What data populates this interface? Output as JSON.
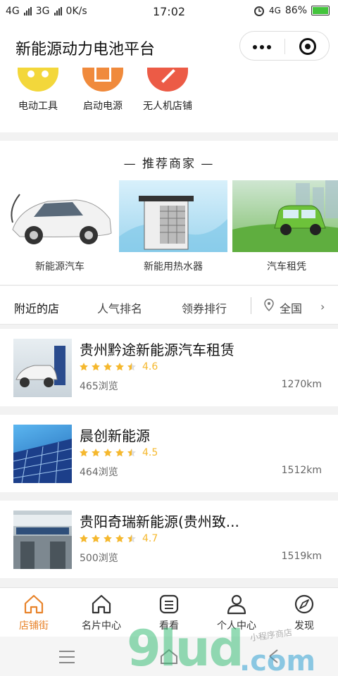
{
  "status_bar": {
    "net1": "4G",
    "net2": "3G",
    "speed": "0K/s",
    "time": "17:02",
    "net3": "4G",
    "battery": "86%"
  },
  "nav": {
    "title": "新能源动力电池平台"
  },
  "categories": [
    {
      "label": "电动工具",
      "color": "#f3d73b"
    },
    {
      "label": "启动电源",
      "color": "#f08a3c"
    },
    {
      "label": "无人机店铺",
      "color": "#ec5b46"
    }
  ],
  "recommend": {
    "heading": "— 推荐商家 —",
    "items": [
      {
        "label": "新能源汽车"
      },
      {
        "label": "新能用热水器"
      },
      {
        "label": "汽车租凭"
      }
    ]
  },
  "filter_tabs": {
    "nearby": "附近的店",
    "popular": "人气排名",
    "coupon": "领券排行",
    "region": "全国"
  },
  "stores": [
    {
      "name": "贵州黔途新能源汽车租赁",
      "rating": "4.6",
      "views": "465浏览",
      "distance": "1270km"
    },
    {
      "name": "晨创新能源",
      "rating": "4.5",
      "views": "464浏览",
      "distance": "1512km"
    },
    {
      "name": "贵阳奇瑞新能源(贵州致...",
      "rating": "4.7",
      "views": "500浏览",
      "distance": "1519km"
    }
  ],
  "tabbar": [
    {
      "label": "店铺街",
      "icon": "home-icon"
    },
    {
      "label": "名片中心",
      "icon": "home-outline-icon"
    },
    {
      "label": "看看",
      "icon": "list-icon"
    },
    {
      "label": "个人中心",
      "icon": "user-icon"
    },
    {
      "label": "发现",
      "icon": "compass-icon"
    }
  ],
  "watermark": {
    "main": "9lud",
    "suffix": ".com",
    "tag": "小程序商店"
  },
  "colors": {
    "accent": "#e8832a",
    "star": "#f5b82e"
  }
}
